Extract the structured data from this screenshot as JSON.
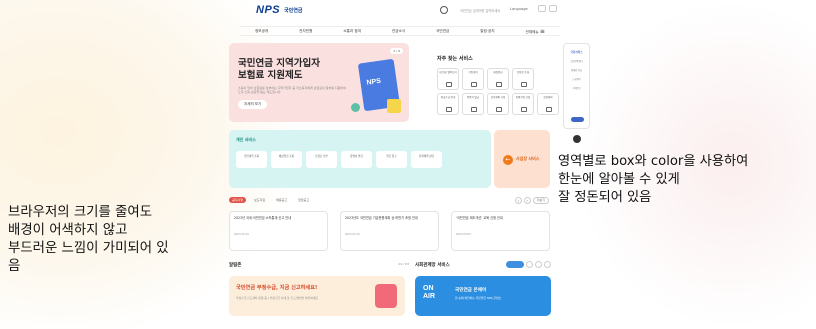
{
  "header": {
    "logo_mark_a": "NPS",
    "logo_text": "국민연금",
    "search_hint": "국민연금 검색어를 입력하세요",
    "language": "Language"
  },
  "gnb": {
    "items": [
      "정보공개",
      "전자민원",
      "소통과 참여",
      "연금소식",
      "국민연금",
      "알림·공지",
      "전체메뉴"
    ]
  },
  "banner": {
    "title": "국민연금 지역가입자\n보험료 지원제도",
    "desc": "소득이 있어 보험료를 납부하는 지역가입자 중 저소득자에게 보험료의 일부를 지원하여 노후 소득 보장을 돕는 제도입니다.",
    "button": "자세히 보기",
    "pager": "2 / 8",
    "illus_text": "NPS"
  },
  "frequent": {
    "title": "자주 찾는 서비스",
    "items": [
      "내 연금 알아보기",
      "가입내역",
      "예상연금",
      "보험료 조회",
      "연금수급 안내",
      "증명서 발급",
      "납부예외 신청",
      "임의가입 신청",
      "연금지급 확인",
      "상담예약"
    ]
  },
  "personal": {
    "title": "개인 서비스",
    "buttons": [
      "가입내역 조회",
      "예상연금 조회",
      "보험료 납부",
      "증명서 발급",
      "연금 청구",
      "전화예약 상담"
    ],
    "business": "사업장 서비스"
  },
  "news": {
    "tabs": [
      "공지사항",
      "보도자료",
      "채용공고",
      "입찰공고"
    ],
    "more": "더보기",
    "cards": [
      {
        "title": "2023년 국세·국민연금 소득통계 신고 안내",
        "date": "2023.10.10"
      },
      {
        "title": "2023년도 국민연금 기금운용계획 상·하반기 조정 안내",
        "date": "2023.09.15"
      },
      {
        "title": "'국민연금 제도개선' 교육 신청 안내",
        "date": "2023.09.05"
      }
    ]
  },
  "promo_left": {
    "head": "알림존",
    "pager": "01 / 03",
    "title": "국민연금 부정수급, 지금 신고하세요!",
    "desc": "부정수급 신고센터 운영 중 | 부정수급 사례 및 신고 방법을 확인하세요"
  },
  "promo_right": {
    "head": "사회관계망 서비스",
    "onair": "ON\nAIR",
    "title": "국민연금 온에어",
    "desc": "한 눈에 확인하는 국민연금 SNS 콘텐츠"
  },
  "quick": {
    "head": "국민서비스",
    "items": [
      "공인인증센터",
      "장애인 연금",
      "노후준비",
      "지역본부"
    ]
  },
  "annotations": {
    "left": [
      "브라우저의 크기를 줄여도",
      "배경이 어색하지 않고",
      "부드러운 느낌이 가미되어 있",
      "음"
    ],
    "right": [
      "영역별로 box와 color을 사용하여",
      "한눈에 알아볼 수 있게",
      "잘 정돈되어 있음"
    ]
  },
  "colors": {
    "brand": "#0a3d8f",
    "accent_orange": "#f07a1a",
    "banner_pink": "#fbe0e0",
    "service_mint": "#d6f4f1",
    "business_peach": "#fde0cf",
    "onair_blue": "#2b8ee0"
  }
}
